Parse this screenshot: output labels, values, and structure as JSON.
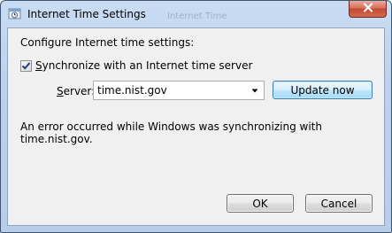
{
  "window": {
    "title": "Internet Time Settings",
    "background_title": "Internet Time",
    "title_icon": "clock-settings-icon",
    "close_icon": "close-icon"
  },
  "content": {
    "heading": "Configure Internet time settings:",
    "sync_checkbox": {
      "label_prefix": "",
      "label_accel": "S",
      "label_rest": "ynchronize with an Internet time server",
      "checked": true
    },
    "server": {
      "label_accel": "S",
      "label_rest": "erver:",
      "value": "time.nist.gov"
    },
    "update_button": "Update now",
    "status_message": "An error occurred while Windows was synchronizing with time.nist.gov."
  },
  "footer": {
    "ok_label": "OK",
    "cancel_label": "Cancel"
  },
  "colors": {
    "accent": "#3c7fb1",
    "close_red": "#c44a32",
    "frame": "#b7cde8"
  }
}
